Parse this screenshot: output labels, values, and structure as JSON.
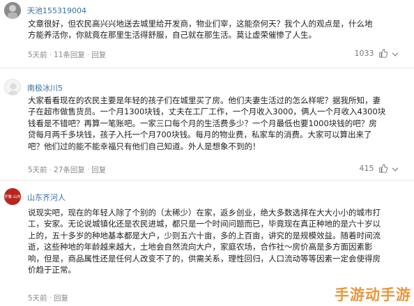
{
  "comments": [
    {
      "username": "天池155319004",
      "lines": [
        "文章很好，但农民高兴兴地送去城里给开发商，物业们宰，这能奈何天？我个人的观点是，什么地",
        "方能养活你，你就竟在那里生活得舒服，自己就在那生活。莫让虚荣催惨了人生。"
      ],
      "date": "5天前",
      "replies": "11条回复",
      "replies_suffix": "",
      "reply": "回复",
      "likes": "1033"
    },
    {
      "username": "南极冰川5",
      "lines": [
        "大家看看现在的农民主要是年轻的孩子们在城里买了房。他们夫妻生活过的怎么样呢？据我所知，妻",
        "子在超市做售货员。一个月1300块钱，丈夫在工厂工作，一个月收入3000，俩人一个月收入4300块",
        "钱看是不错吧？再算一笔账吧。一家三口每个月的生活费多少？一个月最低也要1000块钱的吧？房",
        "贷每月两千多块钱，孩子入托一个月700块钱。每月的物业费，私家车的消费。大家可以算出来了",
        "吧？他们过的能不能幸福只有他们自己知道。外人是想象不到的！"
      ],
      "date": "5天前",
      "replies": "27条回复",
      "replies_suffix": "",
      "reply": "回复",
      "likes": "415"
    },
    {
      "username": "山东齐河人",
      "lines": [
        "说现实吧，现在的年轻人除了个别的（太稀少）在家，返乡创业，绝大多数选择在大大小小的城市打",
        "工，安家。无论说城镇化还是农民进城，都只是一个时间问题而已，毕竟现在真正种地的是六十岁以",
        "上的，五十多岁的种地基本都是大户，少则五六十亩，多的上百亩，讲究的是规模效益。随着时间流",
        "逝，这些种地的年龄越来越大，土地会自然流向大户，家庭农场，合作社～房价高是多方面因素影",
        "响，但是，商品属性还是任何人改变不了的，供需关系，理性回归，人口流动等等因素一定会使得房",
        "价趋于正常。"
      ],
      "date": "5天前",
      "replies": "",
      "replies_suffix": "",
      "reply": "回复",
      "likes": ""
    }
  ],
  "avatar3_text": "齐鲁·山东",
  "watermark": "手游动手游"
}
